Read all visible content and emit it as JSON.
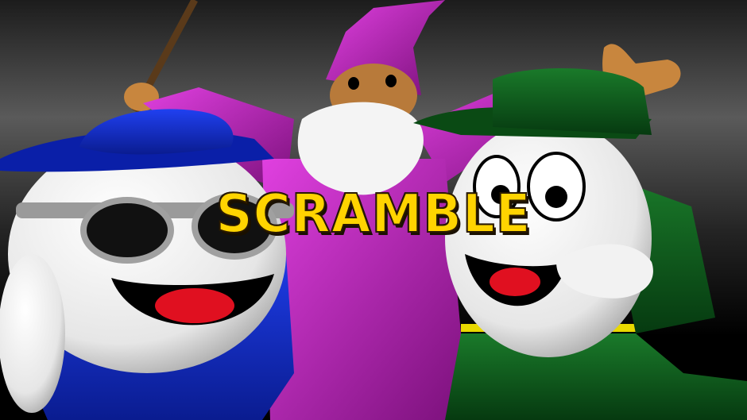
{
  "title": "SCRAMBLE",
  "colors": {
    "title_yellow": "#FFD400",
    "wizard_purple": "#C020C0",
    "blue_hat": "#1030D0",
    "green_hat": "#0E5A1A",
    "egg_white": "#F2F2F2",
    "mouth_red": "#E01020"
  },
  "characters": [
    {
      "name": "blue-egg",
      "role": "left character with blue boater hat and sunglasses"
    },
    {
      "name": "wizard",
      "role": "center wizard with purple pointed hat and white beard"
    },
    {
      "name": "green-egg",
      "role": "right character with green cap"
    }
  ]
}
